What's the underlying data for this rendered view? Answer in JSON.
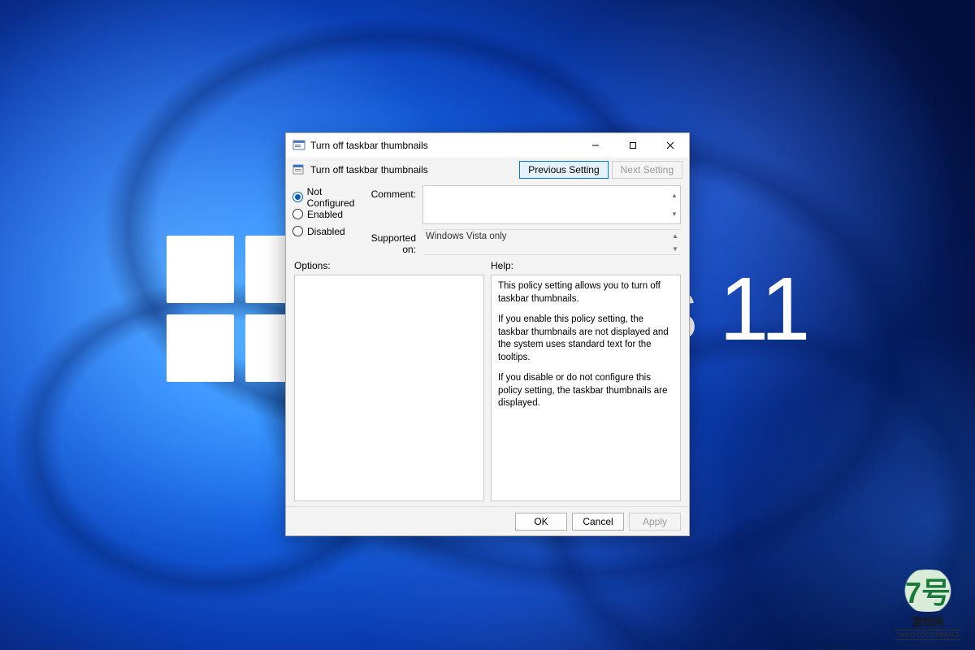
{
  "wallpaper": {
    "brand_text": "Windows 11"
  },
  "window": {
    "title": "Turn off taskbar thumbnails",
    "controls": {
      "minimize": "–",
      "maximize": "□",
      "close": "✕"
    }
  },
  "policy": {
    "title": "Turn off taskbar thumbnails",
    "nav": {
      "previous": "Previous Setting",
      "next": "Next Setting"
    },
    "radios": {
      "not_configured": "Not Configured",
      "enabled": "Enabled",
      "disabled": "Disabled",
      "selected": "not_configured"
    },
    "labels": {
      "comment": "Comment:",
      "supported": "Supported on:",
      "options": "Options:",
      "help": "Help:"
    },
    "comment_value": "",
    "supported_value": "Windows Vista only",
    "options_value": "",
    "help_paragraphs": [
      "This policy setting allows you to turn off taskbar thumbnails.",
      "If you enable this policy setting, the taskbar thumbnails are not displayed and the system uses standard text for the tooltips.",
      "If you disable or do not configure this policy setting, the taskbar thumbnails are displayed."
    ]
  },
  "footer": {
    "ok": "OK",
    "cancel": "Cancel",
    "apply": "Apply"
  },
  "watermark": {
    "num": "7号",
    "cn": "游戏网",
    "py": "7HAOYOUXIWANG"
  }
}
